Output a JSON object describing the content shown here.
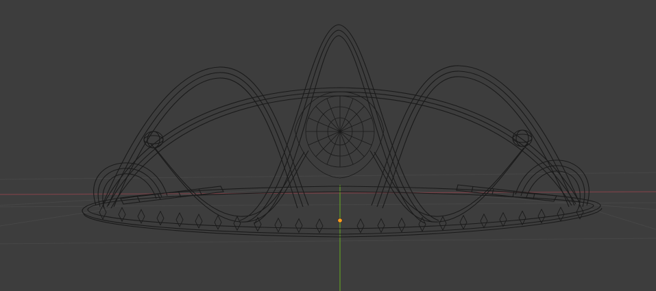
{
  "viewport": {
    "mode": "wireframe",
    "background_color": "#3d3d3d"
  },
  "grid": {
    "floor_color": "#474747",
    "x_axis_color": "#7a4248",
    "z_axis_color": "#5a8a2a"
  },
  "object": {
    "wire_color": "#1a1a1a",
    "origin_color": "#ff9a1e"
  }
}
